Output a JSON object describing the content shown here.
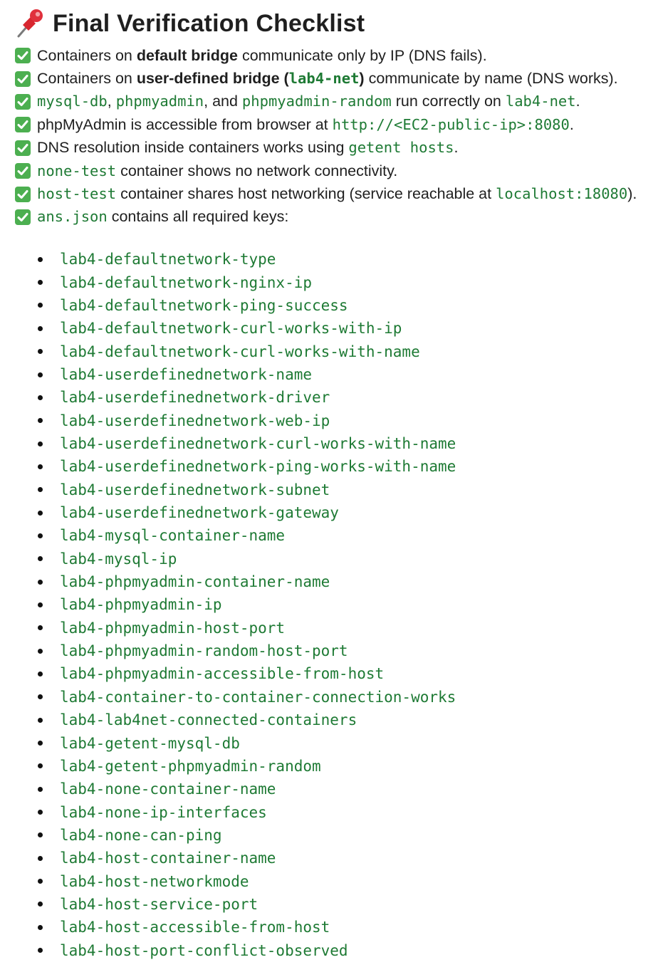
{
  "heading": {
    "icon": "pushpin-icon",
    "title": "Final Verification Checklist"
  },
  "checklist": [
    {
      "icon": "check-mark-button-icon",
      "parts": [
        {
          "t": "text",
          "v": "Containers on "
        },
        {
          "t": "bold",
          "v": "default bridge"
        },
        {
          "t": "text",
          "v": " communicate only by IP (DNS fails)."
        }
      ]
    },
    {
      "icon": "check-mark-button-icon",
      "parts": [
        {
          "t": "text",
          "v": "Containers on "
        },
        {
          "t": "bold",
          "v": "user-defined bridge ("
        },
        {
          "t": "boldcode",
          "v": "lab4-net"
        },
        {
          "t": "bold",
          "v": ")"
        },
        {
          "t": "text",
          "v": " communicate by name (DNS works)."
        }
      ]
    },
    {
      "icon": "check-mark-button-icon",
      "parts": [
        {
          "t": "code",
          "v": "mysql-db"
        },
        {
          "t": "text",
          "v": ", "
        },
        {
          "t": "code",
          "v": "phpmyadmin"
        },
        {
          "t": "text",
          "v": ", and "
        },
        {
          "t": "code",
          "v": "phpmyadmin-random"
        },
        {
          "t": "text",
          "v": " run correctly on "
        },
        {
          "t": "code",
          "v": "lab4-net"
        },
        {
          "t": "text",
          "v": "."
        }
      ]
    },
    {
      "icon": "check-mark-button-icon",
      "parts": [
        {
          "t": "text",
          "v": "phpMyAdmin is accessible from browser at "
        },
        {
          "t": "code",
          "v": "http://<EC2-public-ip>:8080"
        },
        {
          "t": "text",
          "v": "."
        }
      ]
    },
    {
      "icon": "check-mark-button-icon",
      "parts": [
        {
          "t": "text",
          "v": "DNS resolution inside containers works using "
        },
        {
          "t": "code",
          "v": "getent hosts"
        },
        {
          "t": "text",
          "v": "."
        }
      ]
    },
    {
      "icon": "check-mark-button-icon",
      "parts": [
        {
          "t": "code",
          "v": "none-test"
        },
        {
          "t": "text",
          "v": " container shows no network connectivity."
        }
      ]
    },
    {
      "icon": "check-mark-button-icon",
      "parts": [
        {
          "t": "code",
          "v": "host-test"
        },
        {
          "t": "text",
          "v": " container shares host networking (service reachable at "
        },
        {
          "t": "code",
          "v": "localhost:18080"
        },
        {
          "t": "text",
          "v": ")."
        }
      ]
    },
    {
      "icon": "check-mark-button-icon",
      "parts": [
        {
          "t": "code",
          "v": "ans.json"
        },
        {
          "t": "text",
          "v": " contains all required keys:"
        }
      ]
    }
  ],
  "required_keys": [
    "lab4-defaultnetwork-type",
    "lab4-defaultnetwork-nginx-ip",
    "lab4-defaultnetwork-ping-success",
    "lab4-defaultnetwork-curl-works-with-ip",
    "lab4-defaultnetwork-curl-works-with-name",
    "lab4-userdefinednetwork-name",
    "lab4-userdefinednetwork-driver",
    "lab4-userdefinednetwork-web-ip",
    "lab4-userdefinednetwork-curl-works-with-name",
    "lab4-userdefinednetwork-ping-works-with-name",
    "lab4-userdefinednetwork-subnet",
    "lab4-userdefinednetwork-gateway",
    "lab4-mysql-container-name",
    "lab4-mysql-ip",
    "lab4-phpmyadmin-container-name",
    "lab4-phpmyadmin-ip",
    "lab4-phpmyadmin-host-port",
    "lab4-phpmyadmin-random-host-port",
    "lab4-phpmyadmin-accessible-from-host",
    "lab4-container-to-container-connection-works",
    "lab4-lab4net-connected-containers",
    "lab4-getent-mysql-db",
    "lab4-getent-phpmyadmin-random",
    "lab4-none-container-name",
    "lab4-none-ip-interfaces",
    "lab4-none-can-ping",
    "lab4-host-container-name",
    "lab4-host-networkmode",
    "lab4-host-service-port",
    "lab4-host-accessible-from-host",
    "lab4-host-port-conflict-observed"
  ]
}
